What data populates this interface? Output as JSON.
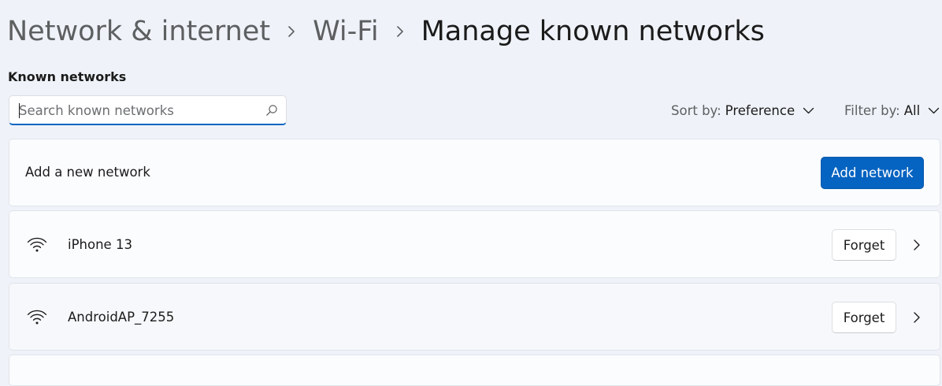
{
  "breadcrumb": {
    "items": [
      "Network & internet",
      "Wi-Fi"
    ],
    "current": "Manage known networks"
  },
  "known_networks": {
    "section_label": "Known networks",
    "search": {
      "placeholder": "Search known networks",
      "value": ""
    },
    "sort": {
      "prefix": "Sort by:",
      "value": "Preference"
    },
    "filter": {
      "prefix": "Filter by:",
      "value": "All"
    },
    "add": {
      "label": "Add a new network",
      "button_label": "Add network"
    },
    "networks": [
      {
        "name": "iPhone 13",
        "icon": "wifi-icon",
        "forget_label": "Forget"
      },
      {
        "name": "AndroidAP_7255",
        "icon": "wifi-icon",
        "forget_label": "Forget"
      }
    ]
  },
  "colors": {
    "accent": "#0563c1",
    "page_background": "#eff3f9",
    "card_background": "#fbfcfe"
  }
}
